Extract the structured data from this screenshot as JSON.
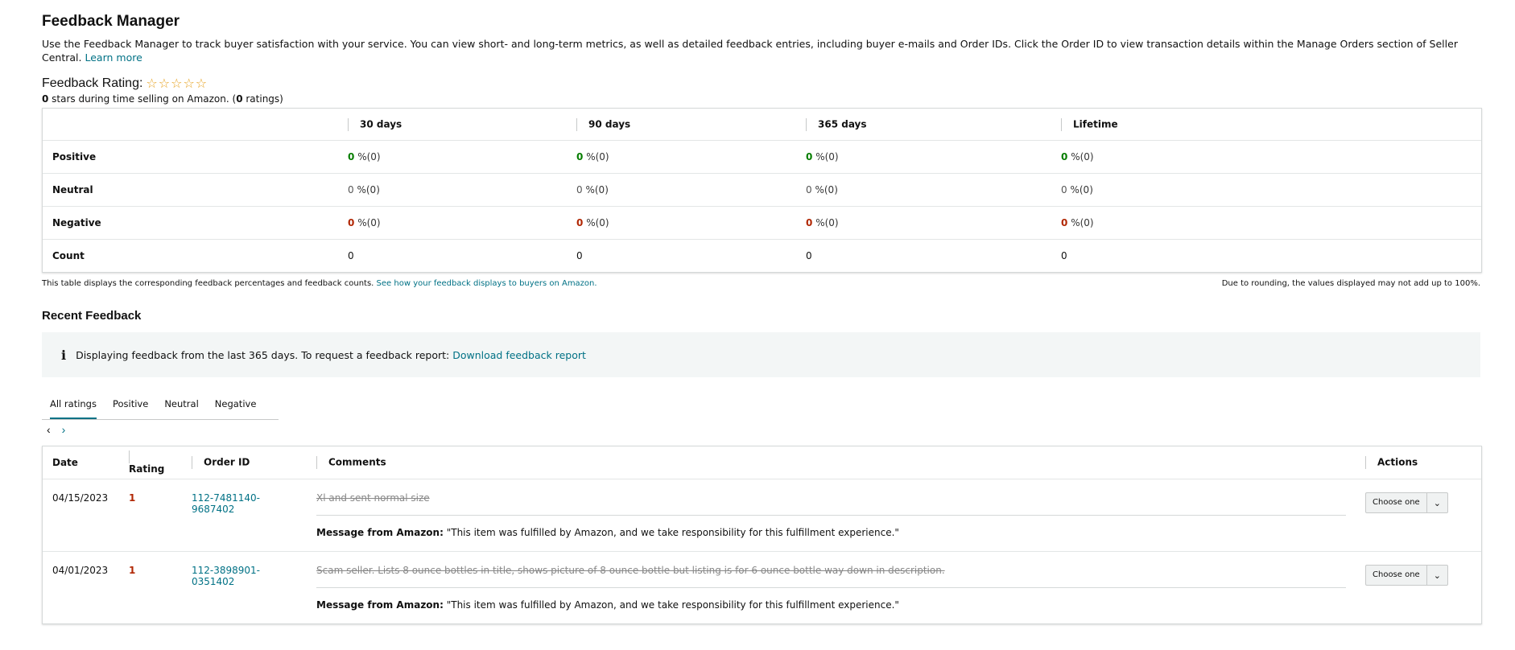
{
  "header": {
    "title": "Feedback Manager",
    "intro": "Use the Feedback Manager to track buyer satisfaction with your service. You can view short- and long-term metrics, as well as detailed feedback entries, including buyer e-mails and Order IDs. Click the Order ID to view transaction details within the Manage Orders section of Seller Central.",
    "learn_more": "Learn more"
  },
  "rating": {
    "title": "Feedback Rating:",
    "stars": "☆☆☆☆☆",
    "stars_count": "0",
    "sub_mid": " stars during time selling on Amazon. (",
    "ratings_count": "0",
    "sub_end": " ratings)"
  },
  "metrics": {
    "columns": [
      "30 days",
      "90 days",
      "365 days",
      "Lifetime"
    ],
    "rows": {
      "positive": {
        "label": "Positive",
        "values": [
          "0",
          "0",
          "0",
          "0"
        ],
        "suffix": [
          "%(0)",
          "%(0)",
          "%(0)",
          "%(0)"
        ]
      },
      "neutral": {
        "label": "Neutral",
        "values": [
          "0",
          "0",
          "0",
          "0"
        ],
        "suffix": [
          "%(0)",
          "%(0)",
          "%(0)",
          "%(0)"
        ]
      },
      "negative": {
        "label": "Negative",
        "values": [
          "0",
          "0",
          "0",
          "0"
        ],
        "suffix": [
          "%(0)",
          "%(0)",
          "%(0)",
          "%(0)"
        ]
      },
      "count": {
        "label": "Count",
        "values": [
          "0",
          "0",
          "0",
          "0"
        ]
      }
    },
    "note_left": "This table displays the corresponding feedback percentages and feedback counts.",
    "note_link": "See how your feedback displays to buyers on Amazon.",
    "note_right": "Due to rounding, the values displayed may not add up to 100%."
  },
  "recent": {
    "title": "Recent Feedback",
    "info_icon": "i",
    "info_text": "Displaying feedback from the last 365 days. To request a feedback report:",
    "info_link": "Download feedback report",
    "tabs": [
      "All ratings",
      "Positive",
      "Neutral",
      "Negative"
    ],
    "pager_prev": "‹",
    "pager_next": "›",
    "columns": {
      "date": "Date",
      "rating": "Rating",
      "order_id": "Order ID",
      "comments": "Comments",
      "actions": "Actions"
    },
    "rows": [
      {
        "date": "04/15/2023",
        "rating": "1",
        "order_id": "112-7481140-9687402",
        "comment": "Xl and sent normal size",
        "msg_label": "Message from Amazon:",
        "msg_text": " \"This item was fulfilled by Amazon, and we take responsibility for this fulfillment experience.\"",
        "action": "Choose one"
      },
      {
        "date": "04/01/2023",
        "rating": "1",
        "order_id": "112-3898901-0351402",
        "comment": "Scam seller. Lists 8 ounce bottles in title, shows picture of 8 ounce bottle but listing is for 6 ounce bottle way down in description.",
        "msg_label": "Message from Amazon:",
        "msg_text": " \"This item was fulfilled by Amazon, and we take responsibility for this fulfillment experience.\"",
        "action": "Choose one"
      }
    ]
  }
}
